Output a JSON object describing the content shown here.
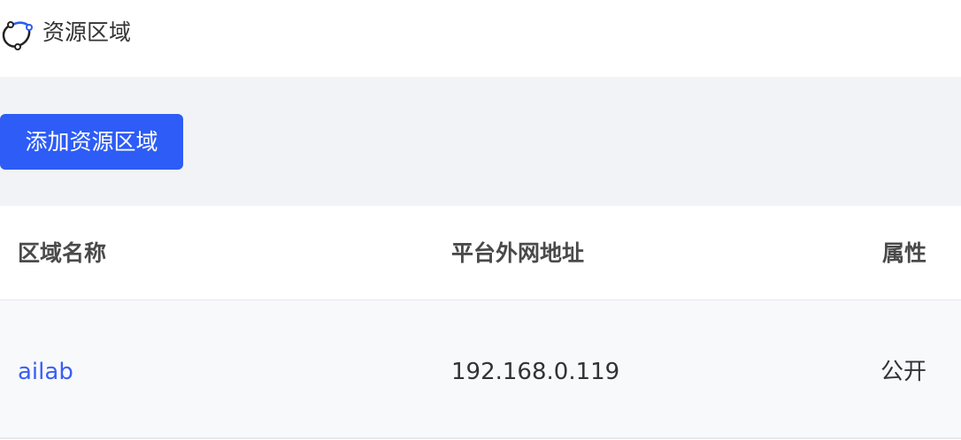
{
  "header": {
    "title": "资源区域"
  },
  "toolbar": {
    "add_button_label": "添加资源区域"
  },
  "table": {
    "columns": [
      "区域名称",
      "平台外网地址",
      "属性"
    ],
    "rows": [
      {
        "name": "ailab",
        "address": "192.168.0.119",
        "attribute": "公开"
      }
    ]
  },
  "colors": {
    "accent": "#2d5cf6",
    "link": "#3a5ef5",
    "toolbar_bg": "#f2f3f6",
    "row_bg": "#f8f9fb"
  }
}
